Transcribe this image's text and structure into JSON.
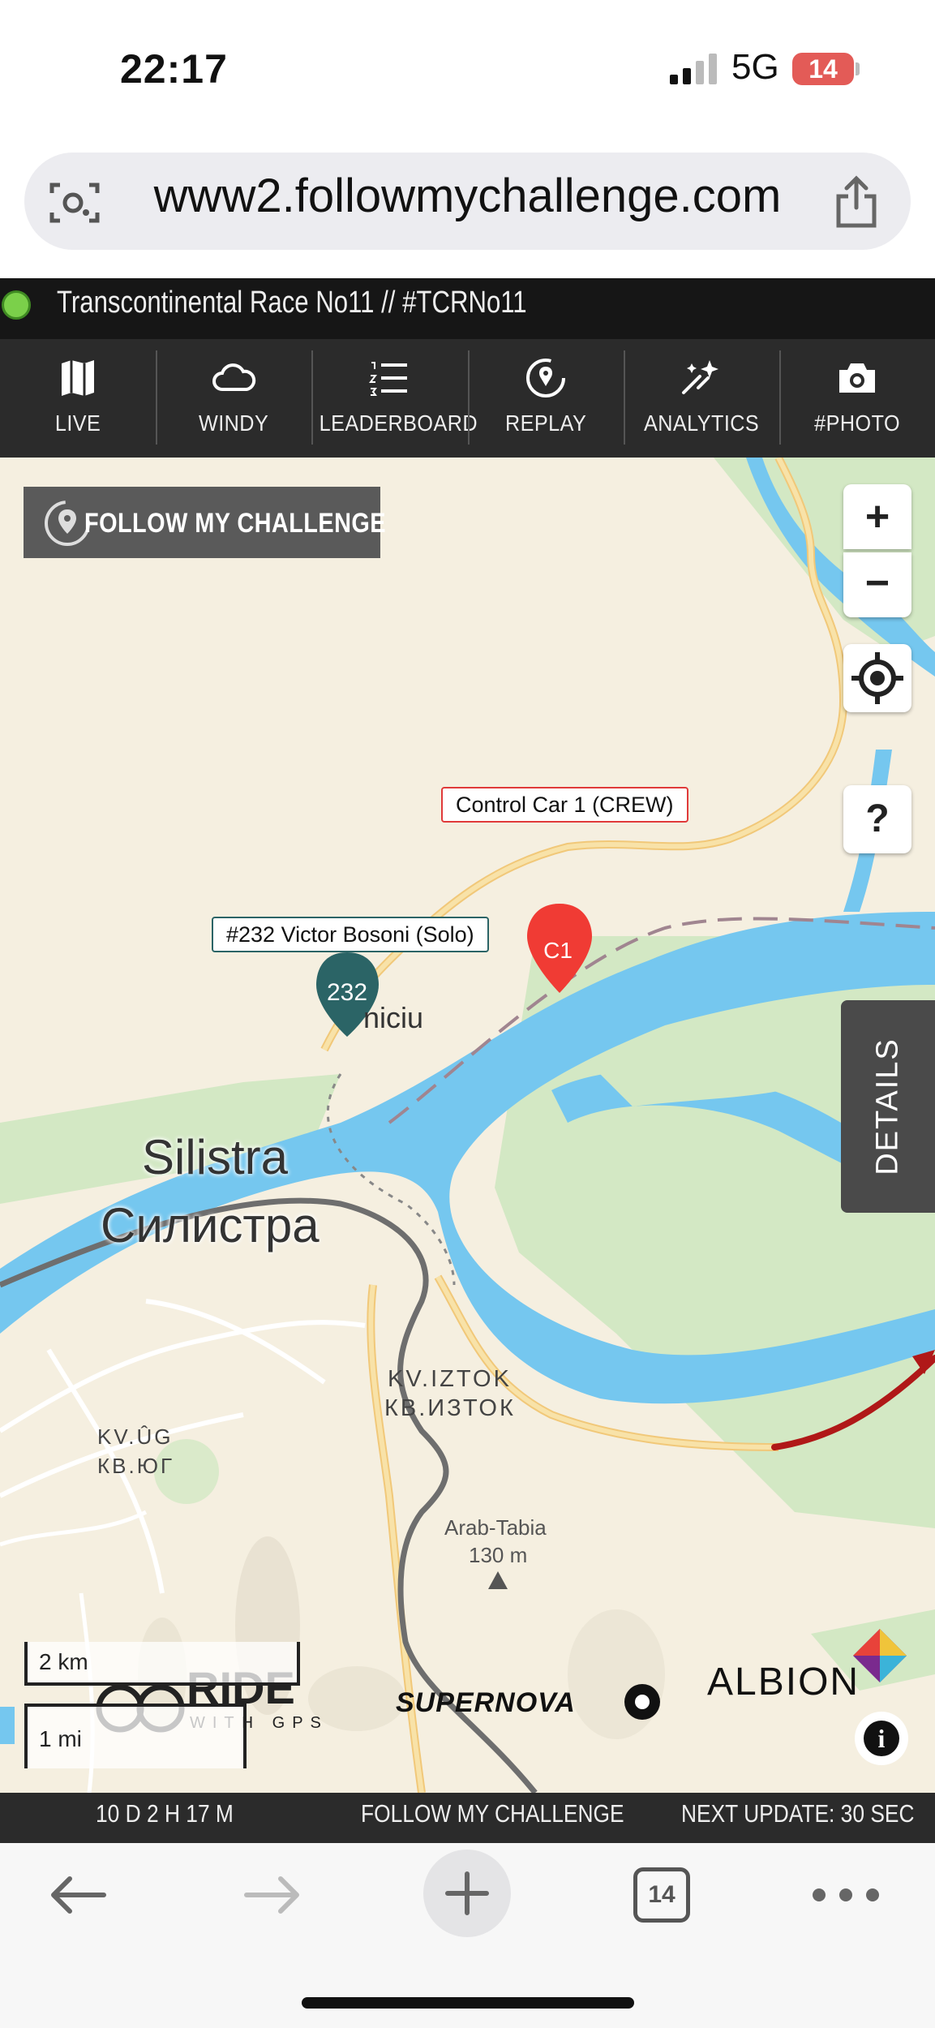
{
  "status": {
    "time": "22:17",
    "network": "5G",
    "battery": "14"
  },
  "browser": {
    "url": "www2.followmychallenge.com",
    "tab_count": "14"
  },
  "event": {
    "title": "Transcontinental Race No11 // #TCRNo11"
  },
  "nav": [
    {
      "label": "LIVE",
      "icon": "map-icon"
    },
    {
      "label": "WINDY",
      "icon": "cloud-icon"
    },
    {
      "label": "LEADERBOARD",
      "icon": "list-icon"
    },
    {
      "label": "REPLAY",
      "icon": "replay-icon"
    },
    {
      "label": "ANALYTICS",
      "icon": "sparkle-icon"
    },
    {
      "label": "#PHOTO",
      "icon": "camera-icon"
    }
  ],
  "map": {
    "brand_logo": "FOLLOW MY CHALLENGE",
    "zoom_in": "+",
    "zoom_out": "−",
    "help": "?",
    "details_tab": "DETAILS",
    "markers": {
      "crew": {
        "callout": "Control Car 1 (CREW)",
        "pin_label": "C1",
        "color": "#f03b34"
      },
      "rider": {
        "callout": "#232 Victor Bosoni (Solo)",
        "pin_label": "232",
        "color": "#2b6466"
      }
    },
    "labels": {
      "city_latin": "Silistra",
      "city_cyrillic": "Силистра",
      "district_east_latin": "KV.IZTOK",
      "district_east_cyrillic": "КВ.ИЗТОК",
      "district_south_latin": "KV.ÛG",
      "district_south_cyrillic": "КВ.ЮГ",
      "peak_name": "Arab-Tabia",
      "peak_elevation": "130 m",
      "village_partial": "niciu"
    },
    "scale": {
      "metric": "2 km",
      "imperial": "1 mi"
    },
    "sponsors": {
      "rwgps_main": "RIDE",
      "rwgps_sub": "WITH GPS",
      "supernova": "SUPERNOVA",
      "albion": "ALBION"
    },
    "info": "i",
    "colors": {
      "water": "#75c7ef",
      "land": "#f5efe0",
      "green": "#cfe6c0",
      "road": "#f7d98b",
      "track": "#b01818"
    }
  },
  "footer": {
    "elapsed": "10 D 2 H 17 M",
    "brand": "FOLLOW MY CHALLENGE",
    "next_update": "NEXT UPDATE: 30 SEC"
  }
}
